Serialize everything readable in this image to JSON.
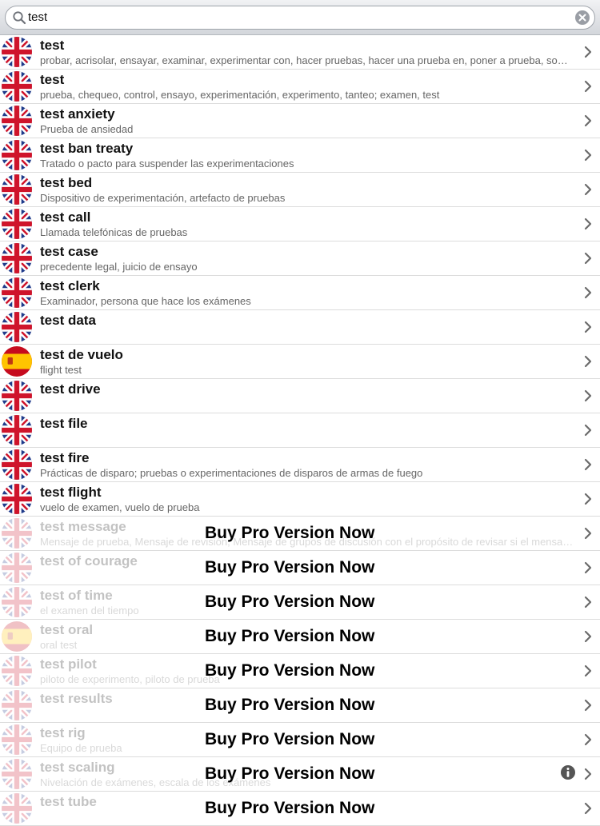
{
  "search": {
    "value": "test",
    "icons": {
      "search": "search-icon",
      "clear": "clear-icon"
    }
  },
  "promo_label": "Buy Pro Version Now",
  "colors": {
    "promo_text": "#000000",
    "meaning_text": "#666666"
  },
  "entries": [
    {
      "term": "test",
      "meaning": "probar, acrisolar, ensayar, examinar, experimentar con, hacer pruebas, hacer una prueba en, poner a prueba, someter a prueba",
      "flag": "uk",
      "locked": false
    },
    {
      "term": "test",
      "meaning": "prueba, chequeo, control, ensayo, experimentación, experimento, tanteo; examen, test",
      "flag": "uk",
      "locked": false
    },
    {
      "term": "test anxiety",
      "meaning": "Prueba de ansiedad",
      "flag": "uk",
      "locked": false
    },
    {
      "term": "test ban treaty",
      "meaning": "Tratado o pacto para suspender las experimentaciones",
      "flag": "uk",
      "locked": false
    },
    {
      "term": "test bed",
      "meaning": "Dispositivo de experimentación, artefacto de pruebas",
      "flag": "uk",
      "locked": false
    },
    {
      "term": "test call",
      "meaning": "Llamada telefónicas de pruebas",
      "flag": "uk",
      "locked": false
    },
    {
      "term": "test case",
      "meaning": "precedente legal, juicio de ensayo",
      "flag": "uk",
      "locked": false
    },
    {
      "term": "test clerk",
      "meaning": "Examinador, persona que hace los exámenes",
      "flag": "uk",
      "locked": false
    },
    {
      "term": "test data",
      "meaning": "",
      "flag": "uk",
      "locked": false
    },
    {
      "term": "test de vuelo",
      "meaning": "flight test",
      "flag": "es",
      "locked": false
    },
    {
      "term": "test drive",
      "meaning": "",
      "flag": "uk",
      "locked": false
    },
    {
      "term": "test file",
      "meaning": "",
      "flag": "uk",
      "locked": false
    },
    {
      "term": "test fire",
      "meaning": "Prácticas de disparo; pruebas o experimentaciones de disparos de armas de fuego",
      "flag": "uk",
      "locked": false
    },
    {
      "term": "test flight",
      "meaning": "vuelo de examen, vuelo de prueba",
      "flag": "uk",
      "locked": false
    },
    {
      "term": "test message",
      "meaning": "Mensaje de prueba, Mensaje de revisión, Mensaje de grupos de discusión con el propósito de revisar si el mensaje funciona",
      "flag": "uk",
      "locked": true
    },
    {
      "term": "test of courage",
      "meaning": "",
      "flag": "uk",
      "locked": true
    },
    {
      "term": "test of time",
      "meaning": "el examen del tiempo",
      "flag": "uk",
      "locked": true
    },
    {
      "term": "test oral",
      "meaning": "oral test",
      "flag": "es",
      "locked": true
    },
    {
      "term": "test pilot",
      "meaning": "piloto de experimento, piloto de prueba",
      "flag": "uk",
      "locked": true
    },
    {
      "term": "test results",
      "meaning": "",
      "flag": "uk",
      "locked": true
    },
    {
      "term": "test rig",
      "meaning": "Equipo de prueba",
      "flag": "uk",
      "locked": true
    },
    {
      "term": "test scaling",
      "meaning": "Nivelación de exámenes, escala de los exámenes",
      "flag": "uk",
      "locked": true,
      "info": true
    },
    {
      "term": "test tube",
      "meaning": "",
      "flag": "uk",
      "locked": true
    }
  ]
}
